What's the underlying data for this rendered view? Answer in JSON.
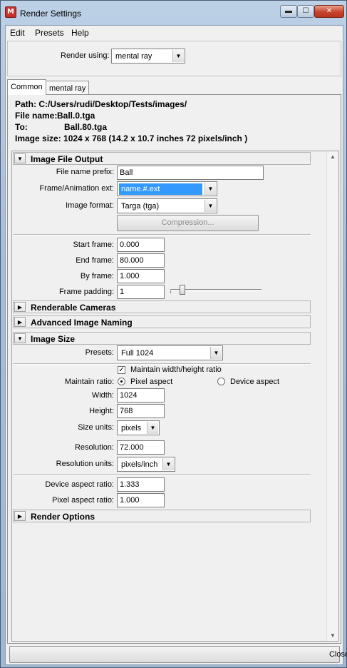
{
  "window": {
    "title": "Render Settings",
    "icon": "maya-app-icon",
    "buttons": {
      "minimize": "▬",
      "maximize": "☐",
      "close": "✕"
    }
  },
  "menu": {
    "edit": "Edit",
    "presets": "Presets",
    "help": "Help"
  },
  "render_using": {
    "label": "Render using:",
    "value": "mental ray"
  },
  "tabs": {
    "common": "Common",
    "mental_ray": "mental ray"
  },
  "info": {
    "path": "Path: C:/Users/rudi/Desktop/Tests/images/",
    "file_name_label": "File name:",
    "file_name": "Ball.0.tga",
    "to_label": "To:",
    "to": "Ball.80.tga",
    "image_size": "Image size: 1024 x 768 (14.2 x 10.7 inches 72 pixels/inch )"
  },
  "image_file_output": {
    "title": "Image File Output",
    "file_name_prefix_label": "File name prefix:",
    "file_name_prefix": "Ball",
    "frame_ext_label": "Frame/Animation ext:",
    "frame_ext": "name.#.ext",
    "image_format_label": "Image format:",
    "image_format": "Targa (tga)",
    "compression_button": "Compression...",
    "start_frame_label": "Start frame:",
    "start_frame": "0.000",
    "end_frame_label": "End frame:",
    "end_frame": "80.000",
    "by_frame_label": "By frame:",
    "by_frame": "1.000",
    "frame_padding_label": "Frame padding:",
    "frame_padding": "1"
  },
  "renderable_cameras": {
    "title": "Renderable Cameras"
  },
  "advanced_image_naming": {
    "title": "Advanced Image Naming"
  },
  "image_size": {
    "title": "Image Size",
    "presets_label": "Presets:",
    "presets": "Full 1024",
    "maintain_wh_label": "Maintain width/height ratio",
    "maintain_ratio_label": "Maintain ratio:",
    "pixel_aspect_label": "Pixel aspect",
    "device_aspect_label": "Device aspect",
    "width_label": "Width:",
    "width": "1024",
    "height_label": "Height:",
    "height": "768",
    "size_units_label": "Size units:",
    "size_units": "pixels",
    "resolution_label": "Resolution:",
    "resolution": "72.000",
    "resolution_units_label": "Resolution units:",
    "resolution_units": "pixels/inch",
    "device_aspect_ratio_label": "Device aspect ratio:",
    "device_aspect_ratio": "1.333",
    "pixel_aspect_ratio_label": "Pixel aspect ratio:",
    "pixel_aspect_ratio": "1.000"
  },
  "render_options": {
    "title": "Render Options"
  },
  "close_button": "Close",
  "glyphs": {
    "arrow_down": "▼",
    "tri_down": "▼",
    "tri_right": "▶",
    "check": "✓",
    "scroll_up": "▲",
    "scroll_down": "▼"
  }
}
